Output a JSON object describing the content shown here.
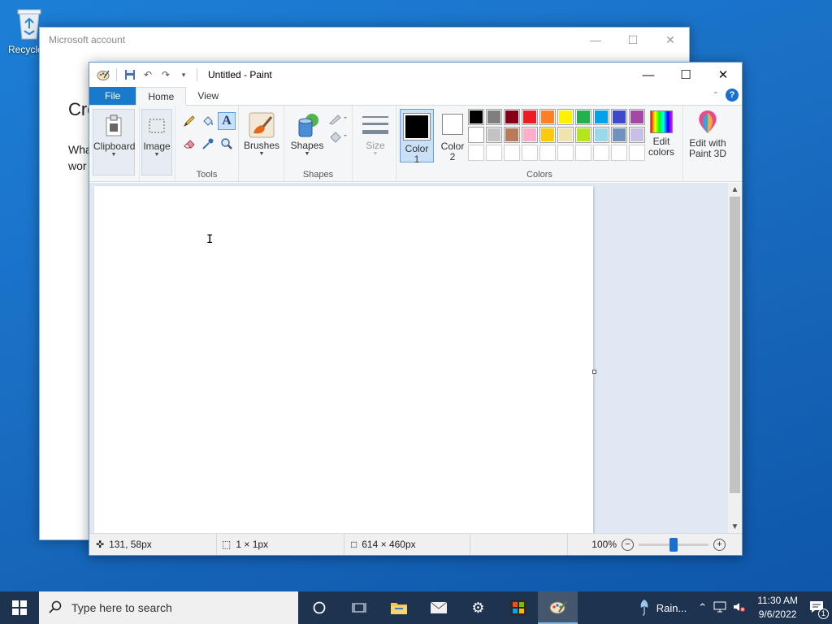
{
  "desktop": {
    "recycle_bin_label": "Recycle"
  },
  "ms_window": {
    "title": "Microsoft account",
    "heading": "Cre",
    "body_line1": "Wha",
    "body_line2": "wor"
  },
  "paint": {
    "title": "Untitled - Paint",
    "tabs": [
      "File",
      "Home",
      "View"
    ],
    "ribbon": {
      "clipboard": "Clipboard",
      "image": "Image",
      "tools_label": "Tools",
      "brushes": "Brushes",
      "shapes": "Shapes",
      "shapes_group_label": "Shapes",
      "size": "Size",
      "color1_line1": "Color",
      "color1_line2": "1",
      "color2_line1": "Color",
      "color2_line2": "2",
      "edit_colors_line1": "Edit",
      "edit_colors_line2": "colors",
      "paint3d_line1": "Edit with",
      "paint3d_line2": "Paint 3D",
      "colors_label": "Colors"
    },
    "palette_row1": [
      "#000000",
      "#7f7f7f",
      "#880015",
      "#ed1c24",
      "#ff7f27",
      "#fff200",
      "#22b14c",
      "#00a2e8",
      "#3f48cc",
      "#a349a4"
    ],
    "palette_row2": [
      "#ffffff",
      "#c3c3c3",
      "#b97a57",
      "#ffaec9",
      "#ffc90e",
      "#efe4b0",
      "#b5e61d",
      "#99d9ea",
      "#7092be",
      "#c8bfe7"
    ],
    "status": {
      "cursor_pos": "131, 58px",
      "selection_size": "1 × 1px",
      "canvas_size": "614 × 460px",
      "zoom": "100%"
    }
  },
  "taskbar": {
    "search_placeholder": "Type here to search",
    "weather": "Rain...",
    "time": "11:30 AM",
    "date": "9/6/2022",
    "notification_count": "1"
  },
  "colors": {
    "accent": "#1979ca",
    "selection": "#c9e0f7"
  }
}
